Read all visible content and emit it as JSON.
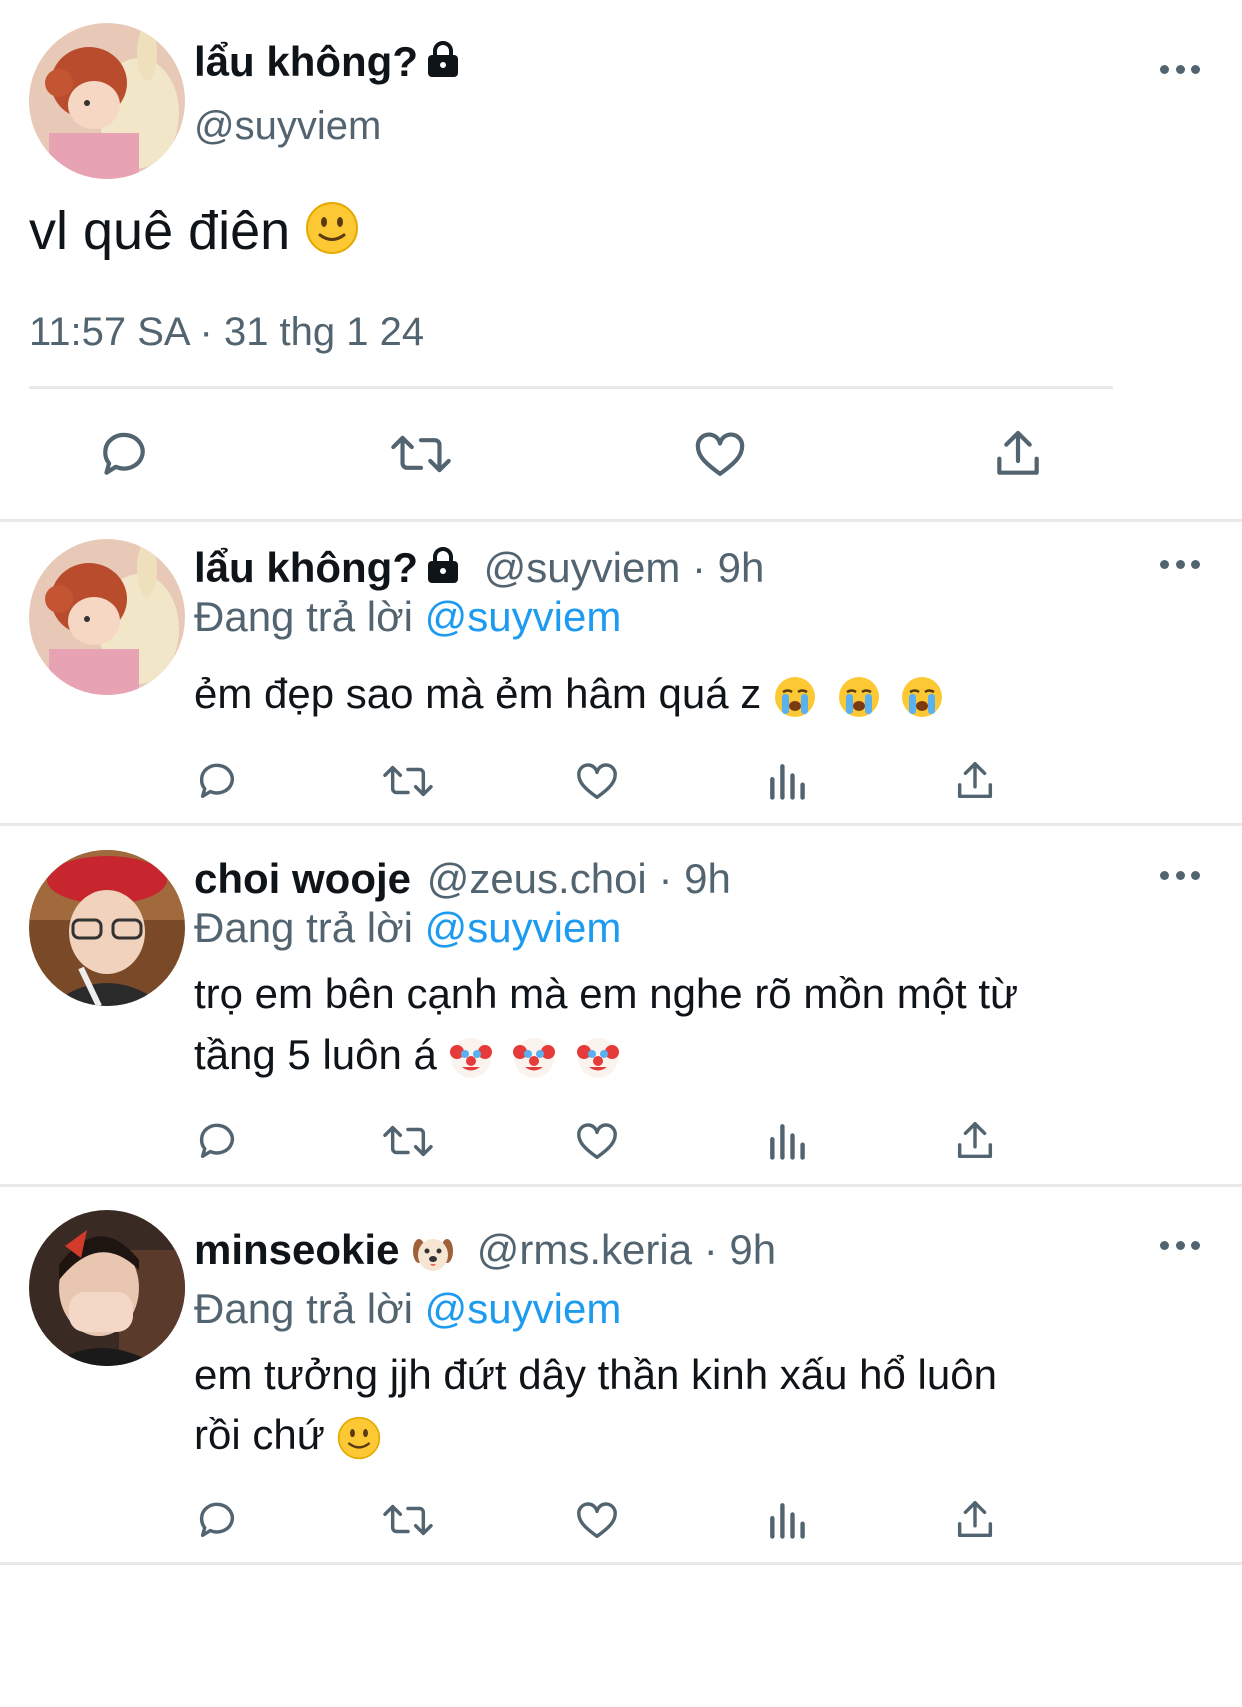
{
  "main_tweet": {
    "display_name": "lẩu không?",
    "handle": "@suyviem",
    "text": "vl quê điên",
    "timestamp": "11:57 SA · 31 thg 1 24",
    "actions": [
      "reply-icon",
      "retweet-icon",
      "like-icon",
      "share-icon"
    ]
  },
  "replies": [
    {
      "display_name": "lẩu không?",
      "handle": "@suyviem",
      "time": "· 9h",
      "replying_label": "Đang trả lời",
      "replying_to": "@suyviem",
      "text_lines": [
        "ẻm đẹp sao mà ẻm hâm quá z"
      ],
      "emoji": "loudly-crying-face x3"
    },
    {
      "display_name": "choi wooje",
      "handle": "@zeus.choi",
      "time": "· 9h",
      "replying_label": "Đang trả lời",
      "replying_to": "@suyviem",
      "text_lines": [
        "trọ em bên cạnh mà em nghe rõ mồn một từ",
        "tầng 5 luôn á"
      ],
      "emoji": "clown-face x3"
    },
    {
      "display_name": "minseokie",
      "handle": "@rms.keria",
      "time": "· 9h",
      "replying_label": "Đang trả lời",
      "replying_to": "@suyviem",
      "text_lines": [
        "em tưởng jjh đứt dây thần kinh xấu hổ luôn",
        "rồi chứ"
      ],
      "emoji": "slightly-smiling-face"
    }
  ],
  "colors": {
    "text": "#0f1419",
    "secondary": "#536471",
    "link": "#1d9bf0",
    "divider": "#e7e9ea"
  }
}
